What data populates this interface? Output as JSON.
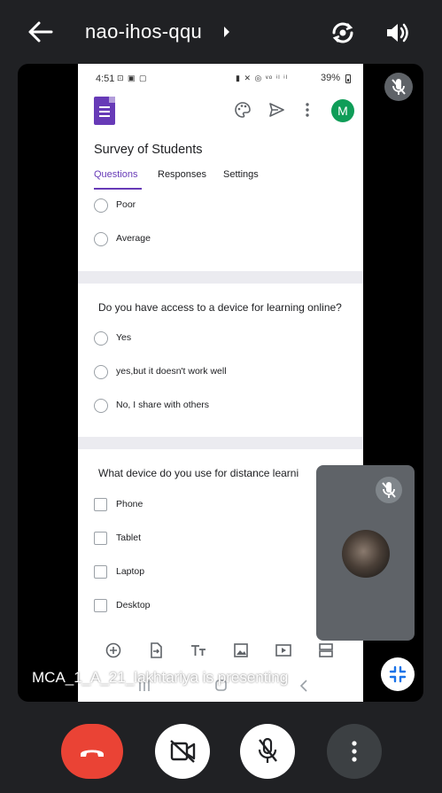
{
  "topbar": {
    "meeting_code": "nao-ihos-qqu",
    "icons": [
      "back-arrow-icon",
      "chevron-right-icon",
      "switch-camera-icon",
      "speaker-icon"
    ]
  },
  "shared_screen": {
    "status_bar": {
      "time": "4:51",
      "left_icons": "⊡ ▣ ▢",
      "right_icons": "▮ ✕ ◎ ᵛᵒ ⁱˡ ⁱˡ",
      "battery": "39%"
    },
    "header": {
      "avatar_initial": "M"
    },
    "form_title": "Survey of Students",
    "tabs": [
      {
        "label": "Questions",
        "active": true
      },
      {
        "label": "Responses",
        "active": false
      },
      {
        "label": "Settings",
        "active": false
      }
    ],
    "q1_options": [
      "Poor",
      "Average"
    ],
    "q2": {
      "question": "Do you have access to a device for learning online?",
      "options": [
        "Yes",
        "yes,but it doesn't work well",
        "No, I share with others"
      ]
    },
    "q3": {
      "question": "What device do you use for distance learni",
      "options": [
        "Phone",
        "Tablet",
        "Laptop",
        "Desktop"
      ]
    }
  },
  "presenting_text": "MCA_1_A_21_lakhtariya is presenting",
  "colors": {
    "background": "#202124",
    "forms_purple": "#673ab7",
    "end_call_red": "#ea4335",
    "avatar_green": "#0f9d58"
  },
  "controls": [
    "end-call",
    "camera-off",
    "mic-off",
    "more-options"
  ]
}
